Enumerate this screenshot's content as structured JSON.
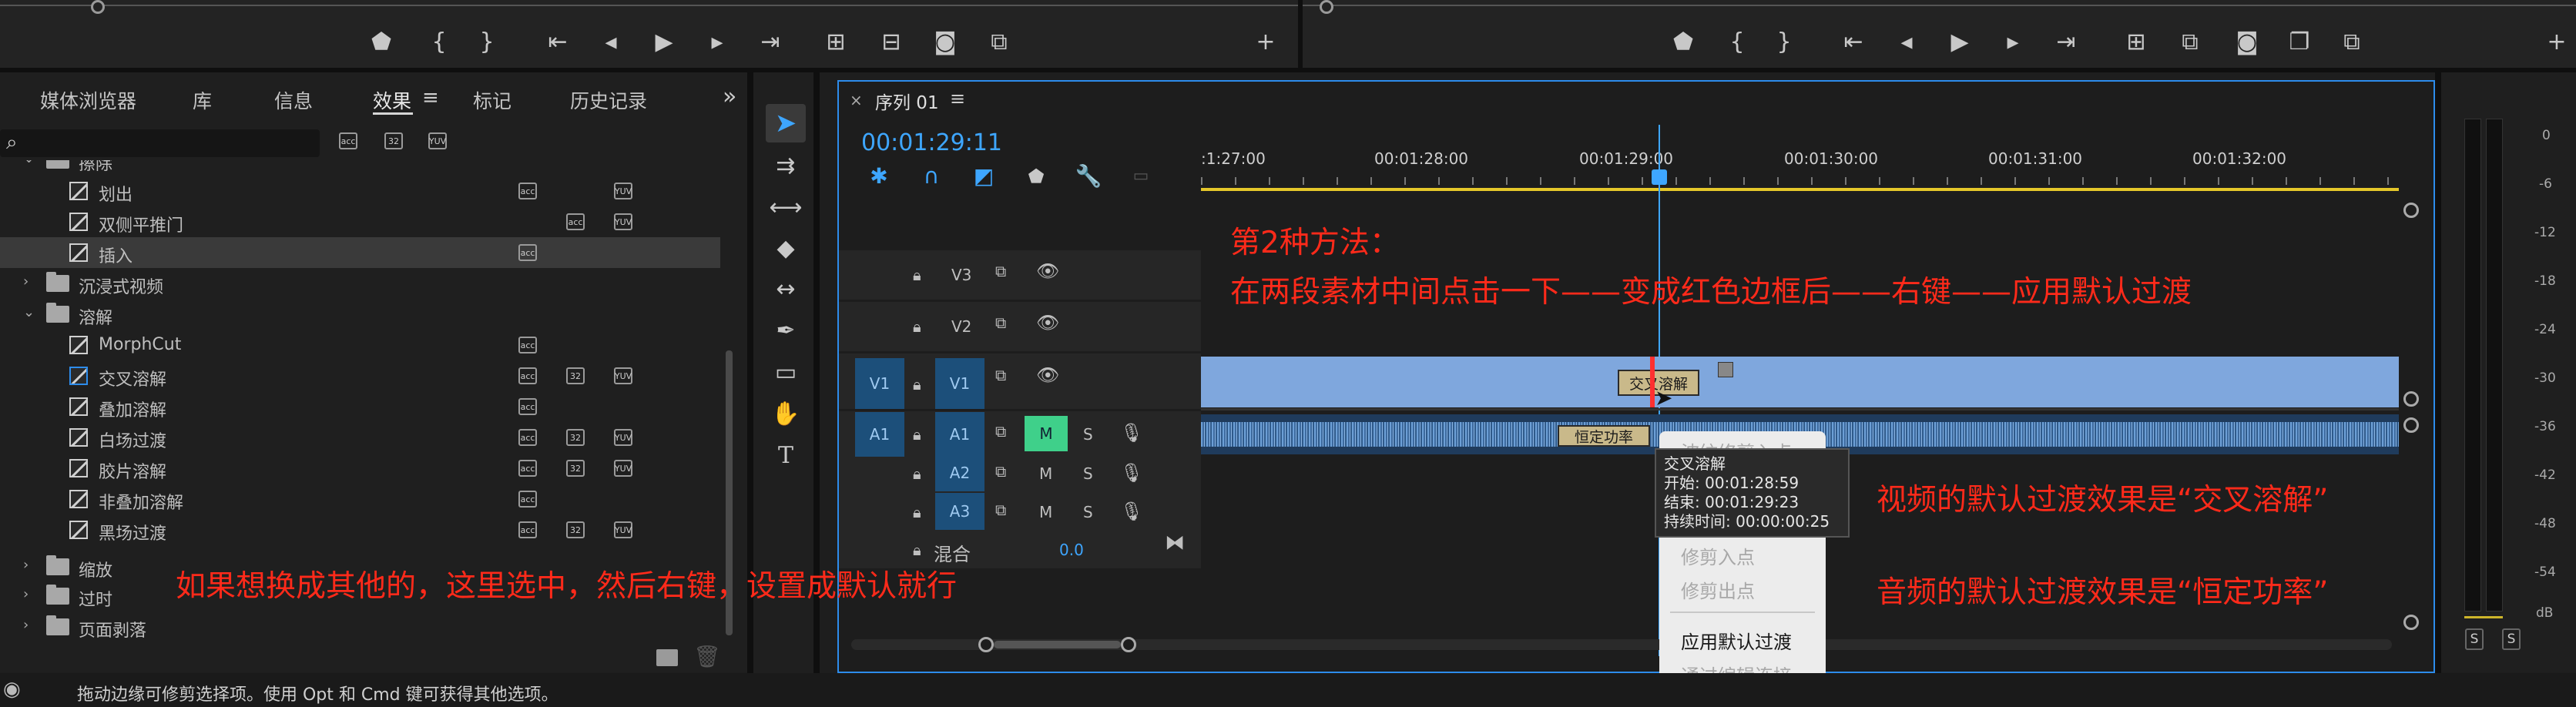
{
  "effects_panel": {
    "tabs": [
      "媒体浏览器",
      "库",
      "信息",
      "效果",
      "标记",
      "历史记录"
    ],
    "active_tab": "效果",
    "search_placeholder": "",
    "filter_badges": [
      "acc",
      "32",
      "YUV"
    ],
    "items": [
      {
        "label": "擦除",
        "kind": "folder",
        "expanded": true
      },
      {
        "label": "划出",
        "kind": "effect",
        "badges": [
          "acc",
          "",
          "YUV"
        ]
      },
      {
        "label": "双侧平推门",
        "kind": "effect",
        "badges": [
          "",
          "acc",
          "YUV"
        ]
      },
      {
        "label": "插入",
        "kind": "effect",
        "badges": [
          "acc",
          "",
          ""
        ],
        "selected": true
      },
      {
        "label": "沉浸式视频",
        "kind": "folder",
        "expanded": false
      },
      {
        "label": "溶解",
        "kind": "folder",
        "expanded": true
      },
      {
        "label": "MorphCut",
        "kind": "effect",
        "badges": [
          "acc",
          "",
          ""
        ]
      },
      {
        "label": "交叉溶解",
        "kind": "effect",
        "badges": [
          "acc",
          "32",
          "YUV"
        ],
        "default": true
      },
      {
        "label": "叠加溶解",
        "kind": "effect",
        "badges": [
          "acc",
          "",
          ""
        ]
      },
      {
        "label": "白场过渡",
        "kind": "effect",
        "badges": [
          "acc",
          "32",
          "YUV"
        ]
      },
      {
        "label": "胶片溶解",
        "kind": "effect",
        "badges": [
          "acc",
          "32",
          "YUV"
        ]
      },
      {
        "label": "非叠加溶解",
        "kind": "effect",
        "badges": [
          "acc",
          "",
          ""
        ]
      },
      {
        "label": "黑场过渡",
        "kind": "effect",
        "badges": [
          "acc",
          "32",
          "YUV"
        ]
      },
      {
        "label": "缩放",
        "kind": "folder",
        "expanded": false
      },
      {
        "label": "过时",
        "kind": "folder",
        "expanded": false
      },
      {
        "label": "页面剥落",
        "kind": "folder",
        "expanded": false
      }
    ]
  },
  "sequence": {
    "tab_label": "序列 01",
    "timecode": "00:01:29:11",
    "ruler_labels": [
      ":1:27:00",
      "00:01:28:00",
      "00:01:29:00",
      "00:01:30:00",
      "00:01:31:00",
      "00:01:32:00"
    ],
    "tracks": {
      "video": [
        "V3",
        "V2",
        "V1"
      ],
      "audio": [
        "A1",
        "A2",
        "A3"
      ],
      "source_v": "V1",
      "source_a": "A1",
      "mix_label": "混合",
      "mix_value": "0.0",
      "m_label": "M",
      "s_label": "S"
    },
    "clips": {
      "video_transition": "交叉溶解",
      "audio_transition": "恒定功率"
    },
    "meter_labels": [
      "0",
      "-6",
      "-12",
      "-18",
      "-24",
      "-30",
      "-36",
      "-42",
      "-48",
      "-54",
      "dB"
    ],
    "meter_solo": [
      "S",
      "S"
    ]
  },
  "tooltip": {
    "title": "交叉溶解",
    "start": "开始: 00:01:28:59",
    "end": "结束: 00:01:29:23",
    "duration": "持续时间: 00:00:00:25"
  },
  "context_menu": {
    "items": [
      {
        "label": "波纹修剪入点",
        "enabled": false
      },
      {
        "label": "修剪入点",
        "enabled": false
      },
      {
        "label": "修剪出点",
        "enabled": false
      },
      {
        "label": "应用默认过渡",
        "enabled": true
      },
      {
        "label": "通过编辑连接",
        "enabled": false
      }
    ]
  },
  "annotations": {
    "method_title": "第2种方法：",
    "method_steps": "在两段素材中间点击一下——变成红色边框后——右键——应用默认过渡",
    "video_default": "视频的默认过渡效果是“交叉溶解”",
    "audio_default": "音频的默认过渡效果是“恒定功率”",
    "other_hint": "如果想换成其他的，这里选中，然后右键，设置成默认就行"
  },
  "status_bar": {
    "text": "拖动边缘可修剪选择项。使用 Opt 和 Cmd 键可获得其他选项。"
  },
  "colors": {
    "accent_blue": "#2d8ceb",
    "annotation_red": "#ff2a1a",
    "clip_video": "#7fa7dd",
    "mute_green": "#3fd08a",
    "timecode": "#3ea6ff"
  }
}
